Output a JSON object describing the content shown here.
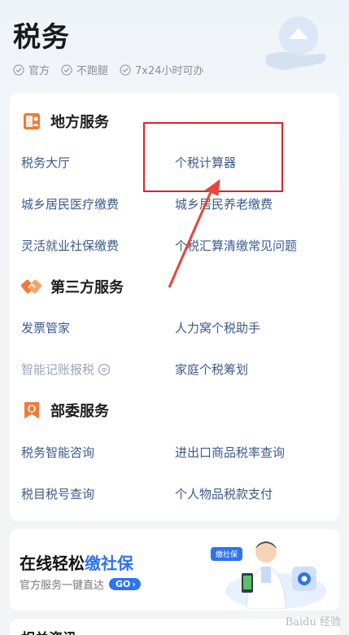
{
  "header": {
    "title": "税务",
    "badges": [
      "官方",
      "不跑腿",
      "7x24小时可办"
    ]
  },
  "sections": [
    {
      "title": "地方服务",
      "icon": "local-service-icon",
      "items": [
        "税务大厅",
        "个税计算器",
        "城乡居民医疗缴费",
        "城乡居民养老缴费",
        "灵活就业社保缴费",
        "个税汇算清缴常见问题"
      ]
    },
    {
      "title": "第三方服务",
      "icon": "handshake-icon",
      "items": [
        "发票管家",
        "人力窝个税助手",
        "智能记账报税",
        "家庭个税筹划"
      ]
    },
    {
      "title": "部委服务",
      "icon": "ministry-seal-icon",
      "items": [
        "税务智能咨询",
        "进出口商品税率查询",
        "税目税号查询",
        "个人物品税款支付"
      ]
    }
  ],
  "banner": {
    "title_prefix": "在线轻松",
    "title_accent": "缴社保",
    "subtitle": "官方服务一键直达",
    "go_label": "GO",
    "tag": "缴社保"
  },
  "bottom": {
    "title": "相关资讯"
  },
  "watermark": "Baidu 经验",
  "colors": {
    "link": "#3b5a8c",
    "accent": "#2e73f0",
    "section_icon": "#f07a3a",
    "highlight": "#d9262c"
  }
}
